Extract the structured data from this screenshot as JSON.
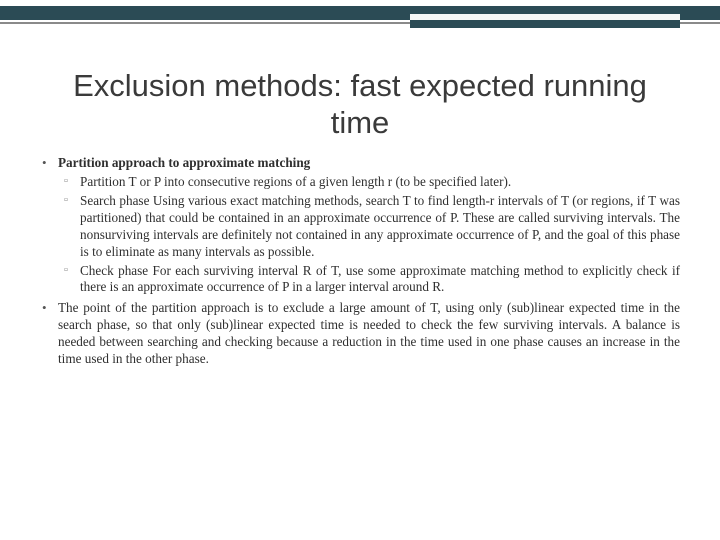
{
  "title": "Exclusion methods: fast expected running time",
  "bullets": {
    "b1": {
      "head": "Partition approach to approximate matching",
      "sub": [
        "Partition T or P into consecutive regions of a given length r (to be specified later).",
        "Search phase Using various exact matching methods, search T to find length-r intervals of T (or regions, if T was partitioned) that could be contained in an approximate occurrence of P. These are called surviving intervals. The nonsurviving intervals are definitely not contained in any approximate occurrence of P, and the goal of this phase is to eliminate as many intervals as possible.",
        "Check phase For each surviving interval R of T, use some approximate matching method to explicitly check if there is an approximate occurrence of P in a larger interval around R."
      ]
    },
    "b2": "The point of the partition approach is to exclude a large amount of T, using only (sub)linear expected time in the search phase, so that only (sub)linear expected time is needed to check the few surviving intervals. A balance is needed between searching and checking because a reduction in the time used in one phase causes an increase in the time used in the other phase."
  }
}
